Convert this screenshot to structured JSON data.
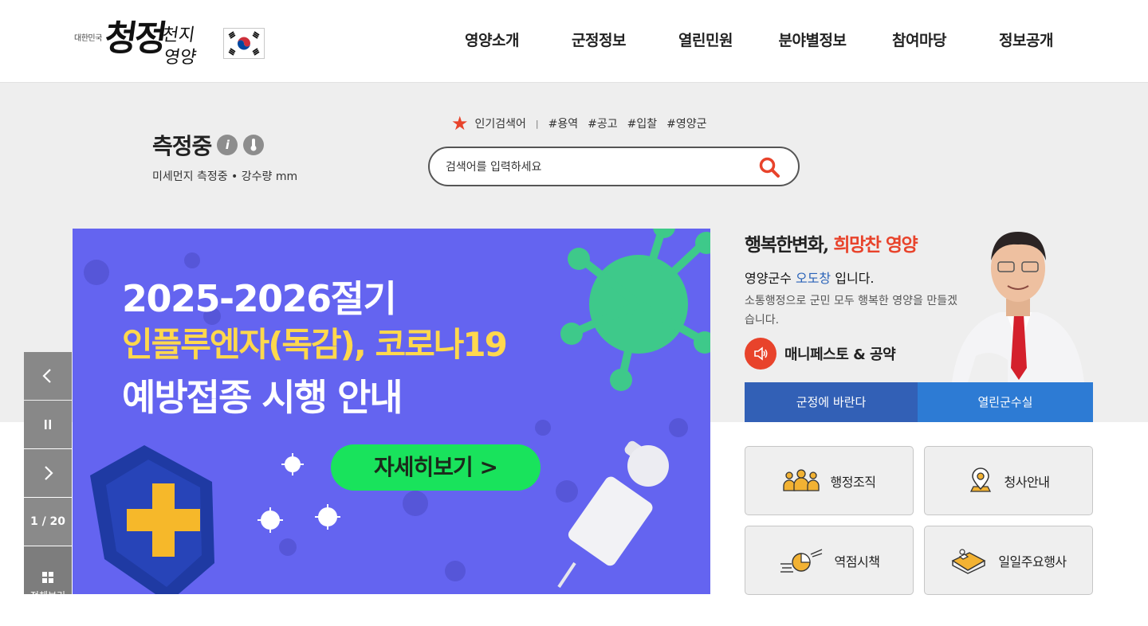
{
  "logo": {
    "small_text": "대한민국",
    "main_text": "청정",
    "sub_text_1": "천지",
    "sub_text_2": "영양"
  },
  "nav": {
    "items": [
      "영양소개",
      "군정정보",
      "열린민원",
      "분야별정보",
      "참여마당",
      "정보공개"
    ]
  },
  "weather": {
    "title": "측정중",
    "info_icon": "i",
    "subtitle": "미세먼지 측정중 • 강수량 mm"
  },
  "search": {
    "popular_label": "인기검색어",
    "separator": "|",
    "tags": [
      "#용역",
      "#공고",
      "#입찰",
      "#영양군"
    ],
    "placeholder": "검색어를 입력하세요"
  },
  "banner": {
    "line1": "2025-2026절기",
    "line2": "인플루엔자(독감), 코로나19",
    "line3": "예방접종 시행 안내",
    "button": "자세히보기 >"
  },
  "slider": {
    "counter": "1 / 20",
    "all_label": "전체보기"
  },
  "mayor": {
    "title_part1": "행복한변화,",
    "title_part2": "희망찬 영양",
    "name_prefix": "영양군수",
    "name": "오도창",
    "name_suffix": "입니다.",
    "description": "소통행정으로 군민 모두 행복한 영양을 만들겠습니다.",
    "manifesto": "매니페스토 & 공약",
    "btn_left": "군정에 바란다",
    "btn_right": "열린군수실"
  },
  "quick": {
    "items": [
      "행정조직",
      "청사안내",
      "역점시책",
      "일일주요행사"
    ]
  },
  "colors": {
    "accent_red": "#e8432b",
    "banner_bg": "#6464f0",
    "blue_dark": "#3260b6",
    "blue_light": "#2d7bd4"
  }
}
